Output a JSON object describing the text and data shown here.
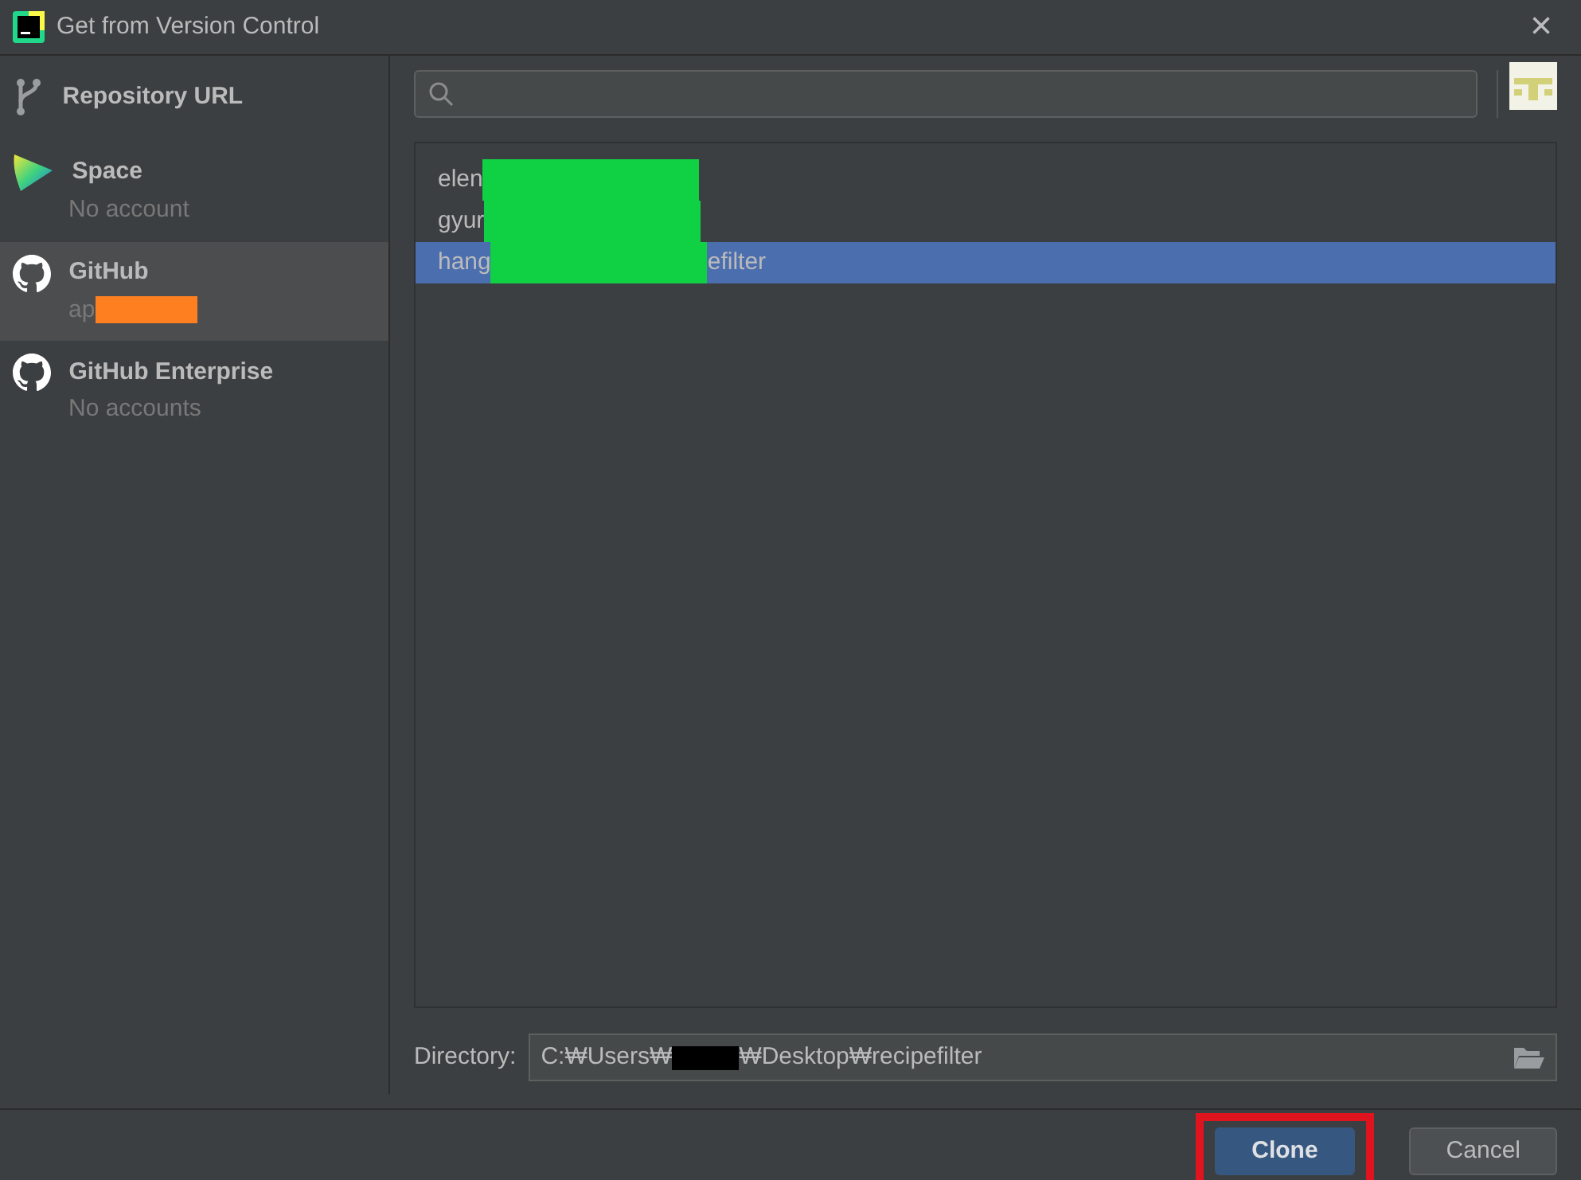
{
  "window": {
    "title": "Get from Version Control",
    "close": "×"
  },
  "sidebar": {
    "items": [
      {
        "kind": "branch",
        "label": "Repository URL",
        "selected": false
      },
      {
        "kind": "space",
        "label": "Space",
        "account": [
          "No account"
        ],
        "redacted": false,
        "selected": false
      },
      {
        "kind": "github",
        "label": "GitHub",
        "account": [
          "ap"
        ],
        "redacted": true,
        "selected": true
      },
      {
        "kind": "github",
        "label": "GitHub Enterprise",
        "account": [
          "No accounts"
        ],
        "redacted": false,
        "selected": false
      }
    ]
  },
  "repositories": [
    {
      "text_parts": [
        "elen"
      ],
      "selected": false
    },
    {
      "text_parts": [
        "gyur"
      ],
      "selected": false
    },
    {
      "text_parts": [
        "hang",
        "efilter"
      ],
      "selected": true
    }
  ],
  "directory": {
    "label": "Directory:",
    "value_parts": [
      "C:₩Users₩",
      "₩Desktop₩recipefilter"
    ]
  },
  "buttons": [
    {
      "kind": "primary",
      "label": "Clone",
      "highlighted": true
    },
    {
      "kind": "secondary",
      "label": "Cancel",
      "highlighted": false
    }
  ]
}
